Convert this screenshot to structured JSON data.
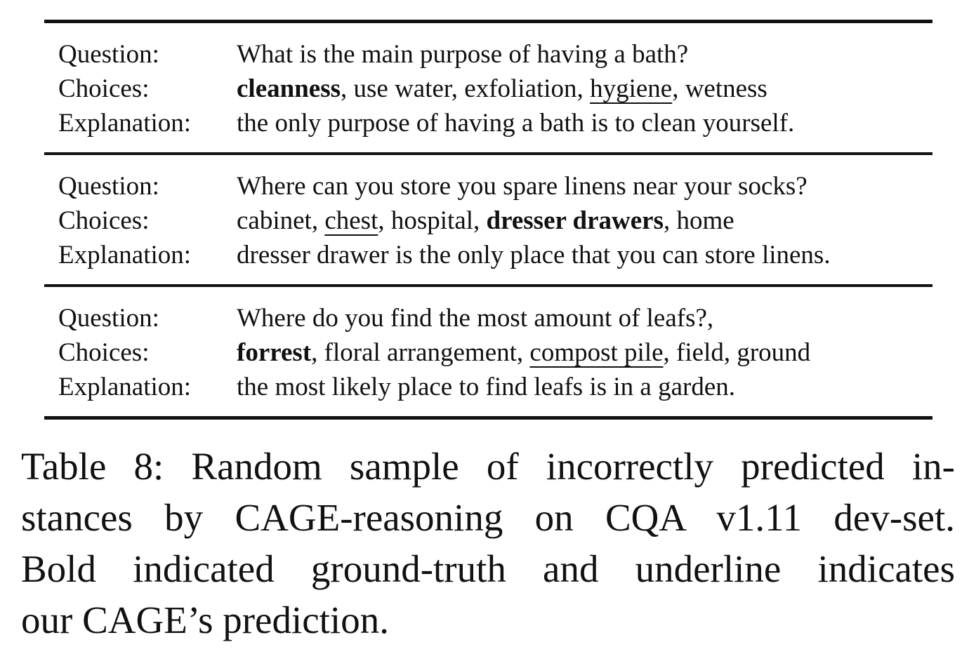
{
  "table": {
    "labels": {
      "question": "Question:",
      "choices": "Choices:",
      "explanation": "Explanation:"
    },
    "rows": [
      {
        "question": "What is the main purpose of having a bath?",
        "choices": [
          {
            "text": "cleanness",
            "bold": true,
            "underline": false
          },
          {
            "text": "use water",
            "bold": false,
            "underline": false
          },
          {
            "text": "exfoliation",
            "bold": false,
            "underline": false
          },
          {
            "text": "hygiene",
            "bold": false,
            "underline": true
          },
          {
            "text": "wetness",
            "bold": false,
            "underline": false
          }
        ],
        "explanation": "the only purpose of having a bath is to clean yourself."
      },
      {
        "question": "Where can you store you spare linens near your socks?",
        "choices": [
          {
            "text": "cabinet",
            "bold": false,
            "underline": false
          },
          {
            "text": "chest",
            "bold": false,
            "underline": true
          },
          {
            "text": "hospital",
            "bold": false,
            "underline": false
          },
          {
            "text": "dresser drawers",
            "bold": true,
            "underline": false
          },
          {
            "text": "home",
            "bold": false,
            "underline": false
          }
        ],
        "explanation": "dresser drawer is the only place that you can store linens."
      },
      {
        "question": "Where do you find the most amount of leafs?,",
        "choices": [
          {
            "text": "forrest",
            "bold": true,
            "underline": false
          },
          {
            "text": "floral arrangement",
            "bold": false,
            "underline": false
          },
          {
            "text": "compost pile",
            "bold": false,
            "underline": true
          },
          {
            "text": "field",
            "bold": false,
            "underline": false
          },
          {
            "text": "ground",
            "bold": false,
            "underline": false
          }
        ],
        "explanation": "the most likely place to find leafs is in a garden."
      }
    ]
  },
  "caption": {
    "lines": [
      "Table 8:  Random sample of incorrectly predicted in-",
      "stances by CAGE-reasoning on CQA v1.11 dev-set.",
      "Bold indicated ground-truth and underline indicates",
      "our CAGE’s prediction."
    ]
  }
}
